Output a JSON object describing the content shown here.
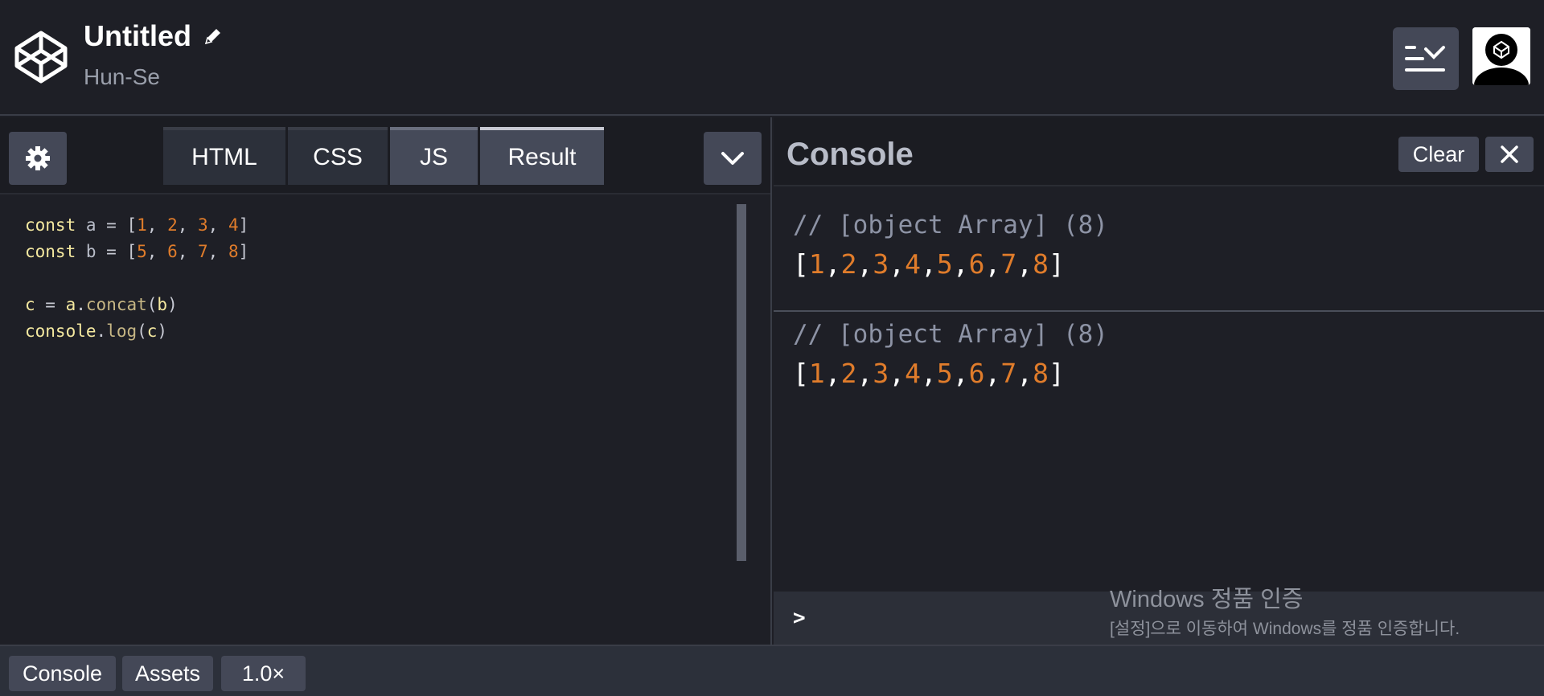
{
  "header": {
    "title": "Untitled",
    "author": "Hun-Se",
    "icons": {
      "logo": "codepen-logo-icon",
      "edit": "pencil-icon",
      "layout": "layout-toggle-icon",
      "avatar": "avatar-codepen-icon"
    }
  },
  "editor": {
    "tabs": [
      {
        "label": "HTML"
      },
      {
        "label": "CSS"
      },
      {
        "label": "JS"
      },
      {
        "label": "Result"
      }
    ],
    "active_tab": "JS",
    "code": {
      "line1": {
        "kw": "const",
        "name": "a",
        "op": " = [",
        "nums": [
          "1",
          "2",
          "3",
          "4"
        ],
        "close": "]"
      },
      "line2": {
        "kw": "const",
        "name": "b",
        "op": " = [",
        "nums": [
          "5",
          "6",
          "7",
          "8"
        ],
        "close": "]"
      },
      "line4": {
        "lhs": "c",
        "op": " = ",
        "obj": "a",
        "method": "concat",
        "arg": "b"
      },
      "line5": {
        "obj": "console",
        "method": "log",
        "arg": "c"
      }
    }
  },
  "console": {
    "title": "Console",
    "clear_label": "Clear",
    "entries": [
      {
        "comment": "// [object Array] (8)",
        "values": [
          "1",
          "2",
          "3",
          "4",
          "5",
          "6",
          "7",
          "8"
        ]
      },
      {
        "comment": "// [object Array] (8)",
        "values": [
          "1",
          "2",
          "3",
          "4",
          "5",
          "6",
          "7",
          "8"
        ]
      }
    ],
    "prompt": ">"
  },
  "watermark": {
    "title": "Windows 정품 인증",
    "subtitle": "[설정]으로 이동하여 Windows를 정품 인증합니다."
  },
  "footer": {
    "console_label": "Console",
    "assets_label": "Assets",
    "zoom_label": "1.0×"
  },
  "colors": {
    "accent_number": "#e07c2b",
    "keyword": "#f5e9a0",
    "button_bg": "#444857",
    "background": "#1e1f26"
  }
}
